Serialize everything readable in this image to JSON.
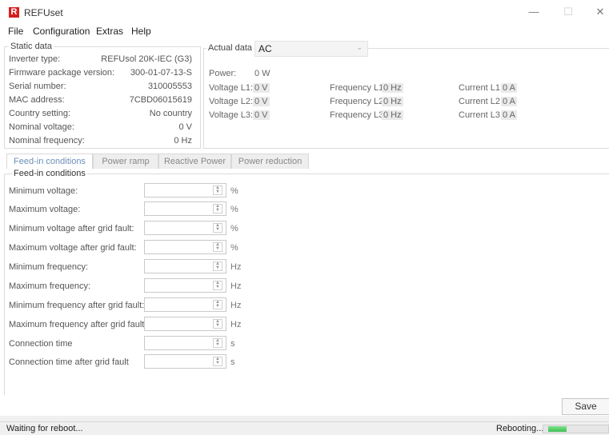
{
  "window": {
    "title": "REFUset",
    "icon_letter": "R",
    "minimize": "—",
    "maximize": "☐",
    "close": "✕"
  },
  "menu": [
    "File",
    "Configuration",
    "Extras",
    "Help"
  ],
  "static_data": {
    "title": "Static data",
    "rows": [
      {
        "label": "Inverter type:",
        "value": "REFUsol 20K-IEC (G3)"
      },
      {
        "label": "Firmware package version:",
        "value": "300-01-07-13-S"
      },
      {
        "label": "Serial number:",
        "value": "310005553"
      },
      {
        "label": "MAC address:",
        "value": "7CBD06015619"
      },
      {
        "label": "Country setting:",
        "value": "No country"
      },
      {
        "label": "Nominal voltage:",
        "value": "0 V"
      },
      {
        "label": "Nominal frequency:",
        "value": "0 Hz"
      }
    ]
  },
  "actual_data": {
    "title": "Actual data",
    "selected": "AC",
    "power": {
      "label": "Power:",
      "value": "0 W"
    },
    "voltages": [
      {
        "label": "Voltage L1:",
        "value": "0 V"
      },
      {
        "label": "Voltage L2:",
        "value": "0 V"
      },
      {
        "label": "Voltage L3:",
        "value": "0 V"
      }
    ],
    "frequencies": [
      {
        "label": "Frequency L1:",
        "value": "0 Hz"
      },
      {
        "label": "Frequency L2:",
        "value": "0 Hz"
      },
      {
        "label": "Frequency L3:",
        "value": "0 Hz"
      }
    ],
    "currents": [
      {
        "label": "Current L1:",
        "value": "0 A"
      },
      {
        "label": "Current L2:",
        "value": "0 A"
      },
      {
        "label": "Current L3:",
        "value": "0 A"
      }
    ]
  },
  "tabs": [
    "Feed-in conditions",
    "Power ramp",
    "Reactive Power",
    "Power reduction"
  ],
  "active_tab": "Feed-in conditions",
  "feed_in": {
    "title": "Feed-in conditions",
    "fields": [
      {
        "label": "Minimum voltage:",
        "value": "",
        "unit": "%"
      },
      {
        "label": "Maximum voltage:",
        "value": "",
        "unit": "%"
      },
      {
        "label": "Minimum voltage after grid fault:",
        "value": "",
        "unit": "%"
      },
      {
        "label": "Maximum voltage after grid fault:",
        "value": "",
        "unit": "%"
      },
      {
        "label": "Minimum frequency:",
        "value": "",
        "unit": "Hz"
      },
      {
        "label": "Maximum frequency:",
        "value": "",
        "unit": "Hz"
      },
      {
        "label": "Minimum frequency after grid fault:",
        "value": "",
        "unit": "Hz"
      },
      {
        "label": "Maximum frequency after grid fault:",
        "value": "",
        "unit": "Hz"
      },
      {
        "label": "Connection time",
        "value": "",
        "unit": "s"
      },
      {
        "label": "Connection time after grid fault",
        "value": "",
        "unit": "s"
      }
    ]
  },
  "save_label": "Save",
  "status": {
    "left": "Waiting for reboot...",
    "right": "Rebooting...",
    "progress_fraction": 0.3
  }
}
